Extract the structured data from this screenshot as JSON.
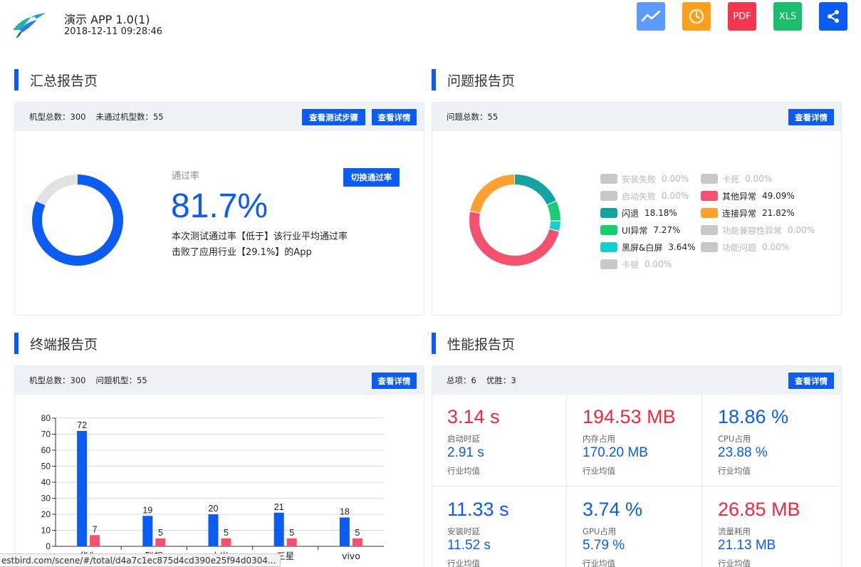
{
  "header": {
    "logo_icon": "hummingbird-logo-icon",
    "title": "演示 APP 1.0(1)",
    "time": "2018-12-11 09:28:46",
    "buttons": [
      {
        "name": "trend-icon",
        "label": "",
        "color": "#5b9bff"
      },
      {
        "name": "clock-icon",
        "label": "",
        "color": "#ff9f1a"
      },
      {
        "name": "pdf-button",
        "label": "PDF",
        "color": "#f5364e"
      },
      {
        "name": "xls-button",
        "label": "XLS",
        "color": "#19c06b"
      },
      {
        "name": "share-icon",
        "label": "",
        "color": "#0a5cf5"
      }
    ]
  },
  "summary": {
    "title": "汇总报告页",
    "total_label": "机型总数：",
    "total_value": "300",
    "failed_label": "未通过机型数：",
    "failed_value": "55",
    "steps_btn": "查看测试步骤",
    "detail_btn": "查看详情",
    "pass_label": "通过率",
    "pass_value": "81.7%",
    "pass_fraction": 0.817,
    "switch_btn": "切换通过率",
    "line1": "本次测试通过率【低于】该行业平均通过率",
    "line2": "击败了应用行业【29.1%】的App"
  },
  "problems": {
    "title": "问题报告页",
    "total_label": "问题总数：",
    "total_value": "55",
    "detail_btn": "查看详情",
    "legend": [
      {
        "label": "安装失败",
        "value": "0.00%",
        "pct": 0,
        "color": "#c8c8c8",
        "active": false
      },
      {
        "label": "卡死",
        "value": "0.00%",
        "pct": 0,
        "color": "#c8c8c8",
        "active": false
      },
      {
        "label": "启动失败",
        "value": "0.00%",
        "pct": 0,
        "color": "#c8c8c8",
        "active": false
      },
      {
        "label": "其他异常",
        "value": "49.09%",
        "pct": 49.09,
        "color": "#f5506e",
        "active": true
      },
      {
        "label": "闪退",
        "value": "18.18%",
        "pct": 18.18,
        "color": "#14a3a3",
        "active": true
      },
      {
        "label": "连接异常",
        "value": "21.82%",
        "pct": 21.82,
        "color": "#ff9f2e",
        "active": true
      },
      {
        "label": "UI异常",
        "value": "7.27%",
        "pct": 7.27,
        "color": "#14d06e",
        "active": true
      },
      {
        "label": "功能兼容性异常",
        "value": "0.00%",
        "pct": 0,
        "color": "#c8c8c8",
        "active": false
      },
      {
        "label": "黑屏&白屏",
        "value": "3.64%",
        "pct": 3.64,
        "color": "#16cfcf",
        "active": true
      },
      {
        "label": "功能问题",
        "value": "0.00%",
        "pct": 0,
        "color": "#c8c8c8",
        "active": false
      },
      {
        "label": "卡顿",
        "value": "0.00%",
        "pct": 0,
        "color": "#c8c8c8",
        "active": false
      }
    ]
  },
  "terminal": {
    "title": "终端报告页",
    "total_label": "机型总数：",
    "total_value": "300",
    "problem_label": "问题机型：",
    "problem_value": "55",
    "detail_btn": "查看详情"
  },
  "performance": {
    "title": "性能报告页",
    "total_label": "总项：",
    "total_value": "6",
    "win_label": "优胜：",
    "win_value": "3",
    "detail_btn": "查看详情",
    "avg_label": "行业均值",
    "cells": [
      {
        "value": "3.14 s",
        "label": "启动时延",
        "avg": "2.91 s",
        "color": "#f0283c"
      },
      {
        "value": "194.53 MB",
        "label": "内存占用",
        "avg": "170.20 MB",
        "color": "#f0283c"
      },
      {
        "value": "18.86 %",
        "label": "CPU占用",
        "avg": "23.88 %",
        "color": "#0a5cf5"
      },
      {
        "value": "11.33 s",
        "label": "安装时延",
        "avg": "11.52 s",
        "color": "#0a5cf5"
      },
      {
        "value": "3.74 %",
        "label": "GPU占用",
        "avg": "5.79 %",
        "color": "#0a5cf5"
      },
      {
        "value": "26.85 MB",
        "label": "流量耗用",
        "avg": "21.13 MB",
        "color": "#f0283c"
      }
    ]
  },
  "status_url": "estbird.com/scene/#/total/d4a7c1ec875d4cd390e25f94d0304...",
  "chart_data": {
    "type": "bar",
    "categories": [
      "华为",
      "联想",
      "小米",
      "三星",
      "vivo"
    ],
    "series": [
      {
        "values": [
          72,
          19,
          20,
          21,
          18
        ],
        "color": "#0a5cf5"
      },
      {
        "values": [
          7,
          5,
          5,
          5,
          5
        ],
        "color": "#f5506e"
      }
    ],
    "ylim": [
      0,
      80
    ],
    "yticks": [
      0,
      10,
      20,
      30,
      40,
      50,
      60,
      70,
      80
    ],
    "grid": true
  }
}
